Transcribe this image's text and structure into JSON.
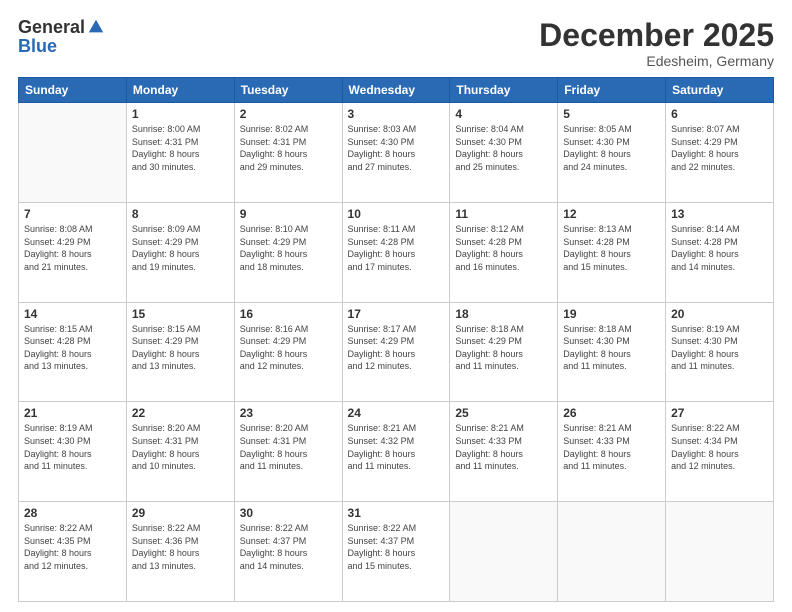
{
  "logo": {
    "general": "General",
    "blue": "Blue"
  },
  "header": {
    "title": "December 2025",
    "subtitle": "Edesheim, Germany"
  },
  "weekdays": [
    "Sunday",
    "Monday",
    "Tuesday",
    "Wednesday",
    "Thursday",
    "Friday",
    "Saturday"
  ],
  "weeks": [
    [
      {
        "day": "",
        "sunrise": "",
        "sunset": "",
        "daylight": ""
      },
      {
        "day": "1",
        "sunrise": "Sunrise: 8:00 AM",
        "sunset": "Sunset: 4:31 PM",
        "daylight": "Daylight: 8 hours and 30 minutes."
      },
      {
        "day": "2",
        "sunrise": "Sunrise: 8:02 AM",
        "sunset": "Sunset: 4:31 PM",
        "daylight": "Daylight: 8 hours and 29 minutes."
      },
      {
        "day": "3",
        "sunrise": "Sunrise: 8:03 AM",
        "sunset": "Sunset: 4:30 PM",
        "daylight": "Daylight: 8 hours and 27 minutes."
      },
      {
        "day": "4",
        "sunrise": "Sunrise: 8:04 AM",
        "sunset": "Sunset: 4:30 PM",
        "daylight": "Daylight: 8 hours and 25 minutes."
      },
      {
        "day": "5",
        "sunrise": "Sunrise: 8:05 AM",
        "sunset": "Sunset: 4:30 PM",
        "daylight": "Daylight: 8 hours and 24 minutes."
      },
      {
        "day": "6",
        "sunrise": "Sunrise: 8:07 AM",
        "sunset": "Sunset: 4:29 PM",
        "daylight": "Daylight: 8 hours and 22 minutes."
      }
    ],
    [
      {
        "day": "7",
        "sunrise": "Sunrise: 8:08 AM",
        "sunset": "Sunset: 4:29 PM",
        "daylight": "Daylight: 8 hours and 21 minutes."
      },
      {
        "day": "8",
        "sunrise": "Sunrise: 8:09 AM",
        "sunset": "Sunset: 4:29 PM",
        "daylight": "Daylight: 8 hours and 19 minutes."
      },
      {
        "day": "9",
        "sunrise": "Sunrise: 8:10 AM",
        "sunset": "Sunset: 4:29 PM",
        "daylight": "Daylight: 8 hours and 18 minutes."
      },
      {
        "day": "10",
        "sunrise": "Sunrise: 8:11 AM",
        "sunset": "Sunset: 4:28 PM",
        "daylight": "Daylight: 8 hours and 17 minutes."
      },
      {
        "day": "11",
        "sunrise": "Sunrise: 8:12 AM",
        "sunset": "Sunset: 4:28 PM",
        "daylight": "Daylight: 8 hours and 16 minutes."
      },
      {
        "day": "12",
        "sunrise": "Sunrise: 8:13 AM",
        "sunset": "Sunset: 4:28 PM",
        "daylight": "Daylight: 8 hours and 15 minutes."
      },
      {
        "day": "13",
        "sunrise": "Sunrise: 8:14 AM",
        "sunset": "Sunset: 4:28 PM",
        "daylight": "Daylight: 8 hours and 14 minutes."
      }
    ],
    [
      {
        "day": "14",
        "sunrise": "Sunrise: 8:15 AM",
        "sunset": "Sunset: 4:28 PM",
        "daylight": "Daylight: 8 hours and 13 minutes."
      },
      {
        "day": "15",
        "sunrise": "Sunrise: 8:15 AM",
        "sunset": "Sunset: 4:29 PM",
        "daylight": "Daylight: 8 hours and 13 minutes."
      },
      {
        "day": "16",
        "sunrise": "Sunrise: 8:16 AM",
        "sunset": "Sunset: 4:29 PM",
        "daylight": "Daylight: 8 hours and 12 minutes."
      },
      {
        "day": "17",
        "sunrise": "Sunrise: 8:17 AM",
        "sunset": "Sunset: 4:29 PM",
        "daylight": "Daylight: 8 hours and 12 minutes."
      },
      {
        "day": "18",
        "sunrise": "Sunrise: 8:18 AM",
        "sunset": "Sunset: 4:29 PM",
        "daylight": "Daylight: 8 hours and 11 minutes."
      },
      {
        "day": "19",
        "sunrise": "Sunrise: 8:18 AM",
        "sunset": "Sunset: 4:30 PM",
        "daylight": "Daylight: 8 hours and 11 minutes."
      },
      {
        "day": "20",
        "sunrise": "Sunrise: 8:19 AM",
        "sunset": "Sunset: 4:30 PM",
        "daylight": "Daylight: 8 hours and 11 minutes."
      }
    ],
    [
      {
        "day": "21",
        "sunrise": "Sunrise: 8:19 AM",
        "sunset": "Sunset: 4:30 PM",
        "daylight": "Daylight: 8 hours and 11 minutes."
      },
      {
        "day": "22",
        "sunrise": "Sunrise: 8:20 AM",
        "sunset": "Sunset: 4:31 PM",
        "daylight": "Daylight: 8 hours and 10 minutes."
      },
      {
        "day": "23",
        "sunrise": "Sunrise: 8:20 AM",
        "sunset": "Sunset: 4:31 PM",
        "daylight": "Daylight: 8 hours and 11 minutes."
      },
      {
        "day": "24",
        "sunrise": "Sunrise: 8:21 AM",
        "sunset": "Sunset: 4:32 PM",
        "daylight": "Daylight: 8 hours and 11 minutes."
      },
      {
        "day": "25",
        "sunrise": "Sunrise: 8:21 AM",
        "sunset": "Sunset: 4:33 PM",
        "daylight": "Daylight: 8 hours and 11 minutes."
      },
      {
        "day": "26",
        "sunrise": "Sunrise: 8:21 AM",
        "sunset": "Sunset: 4:33 PM",
        "daylight": "Daylight: 8 hours and 11 minutes."
      },
      {
        "day": "27",
        "sunrise": "Sunrise: 8:22 AM",
        "sunset": "Sunset: 4:34 PM",
        "daylight": "Daylight: 8 hours and 12 minutes."
      }
    ],
    [
      {
        "day": "28",
        "sunrise": "Sunrise: 8:22 AM",
        "sunset": "Sunset: 4:35 PM",
        "daylight": "Daylight: 8 hours and 12 minutes."
      },
      {
        "day": "29",
        "sunrise": "Sunrise: 8:22 AM",
        "sunset": "Sunset: 4:36 PM",
        "daylight": "Daylight: 8 hours and 13 minutes."
      },
      {
        "day": "30",
        "sunrise": "Sunrise: 8:22 AM",
        "sunset": "Sunset: 4:37 PM",
        "daylight": "Daylight: 8 hours and 14 minutes."
      },
      {
        "day": "31",
        "sunrise": "Sunrise: 8:22 AM",
        "sunset": "Sunset: 4:37 PM",
        "daylight": "Daylight: 8 hours and 15 minutes."
      },
      {
        "day": "",
        "sunrise": "",
        "sunset": "",
        "daylight": ""
      },
      {
        "day": "",
        "sunrise": "",
        "sunset": "",
        "daylight": ""
      },
      {
        "day": "",
        "sunrise": "",
        "sunset": "",
        "daylight": ""
      }
    ]
  ]
}
